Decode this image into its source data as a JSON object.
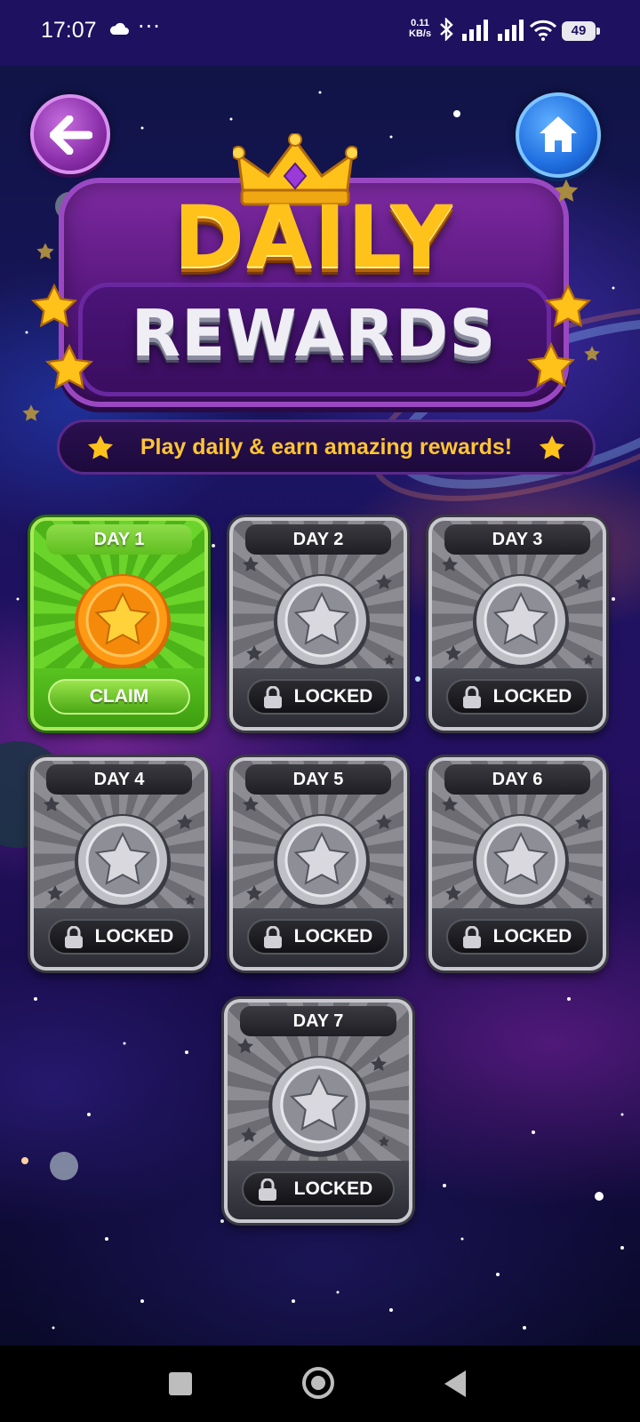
{
  "status_bar": {
    "time": "17:07",
    "weather_icon": "cloud-icon",
    "more_dots": "···",
    "net_speed_value": "0.11",
    "net_speed_unit": "KB/s",
    "battery": "49"
  },
  "header": {
    "back_icon": "arrow-left-icon",
    "home_icon": "home-icon",
    "title_line1": "DAILY",
    "title_line2": "REWARDS",
    "subtitle": "Play daily & earn amazing rewards!"
  },
  "colors": {
    "title_gold": "#ffc21a",
    "claim_green": "#5fbf20",
    "locked_gray": "#8c8c92",
    "banner_purple": "#5a1880"
  },
  "days": [
    {
      "label": "DAY 1",
      "state": "claimable",
      "action": "CLAIM",
      "reward_icon": "gold-star-coin-icon"
    },
    {
      "label": "DAY 2",
      "state": "locked",
      "action": "LOCKED",
      "reward_icon": "silver-star-coin-icon"
    },
    {
      "label": "DAY 3",
      "state": "locked",
      "action": "LOCKED",
      "reward_icon": "silver-star-coin-icon"
    },
    {
      "label": "DAY 4",
      "state": "locked",
      "action": "LOCKED",
      "reward_icon": "silver-star-coin-icon"
    },
    {
      "label": "DAY 5",
      "state": "locked",
      "action": "LOCKED",
      "reward_icon": "silver-star-coin-icon"
    },
    {
      "label": "DAY 6",
      "state": "locked",
      "action": "LOCKED",
      "reward_icon": "silver-star-coin-icon"
    },
    {
      "label": "DAY 7",
      "state": "locked",
      "action": "LOCKED",
      "reward_icon": "silver-star-coin-icon"
    }
  ],
  "nav_bar": {
    "recents_icon": "square-icon",
    "home_icon": "circle-icon",
    "back_icon": "triangle-back-icon"
  }
}
